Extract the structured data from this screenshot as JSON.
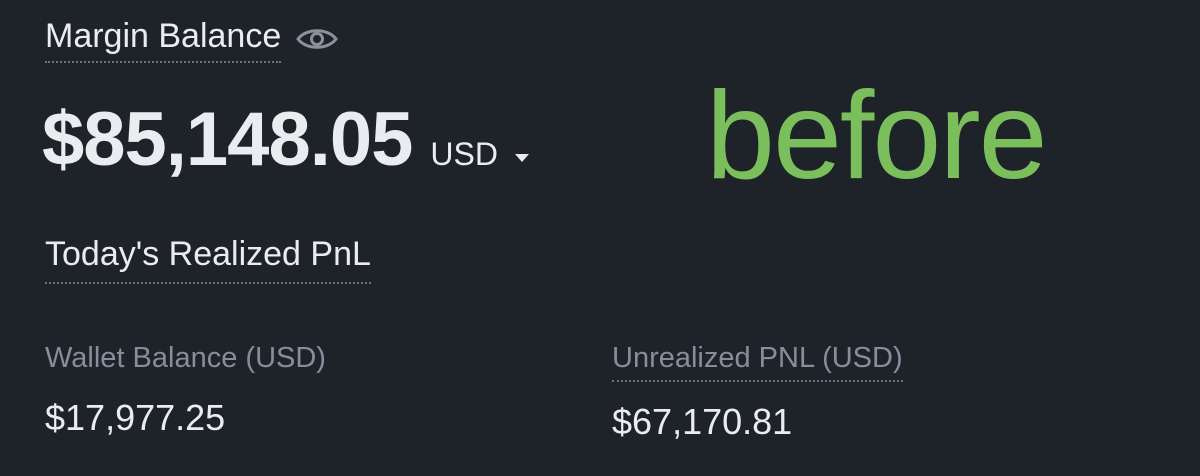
{
  "margin": {
    "label": "Margin Balance",
    "balance": "$85,148.05",
    "currency": "USD",
    "eye_icon": "eye-icon",
    "caret_icon": "caret-down-icon"
  },
  "overlay": {
    "text": "before",
    "color": "#7bbf5d"
  },
  "pnl": {
    "label": "Today's Realized PnL"
  },
  "wallet": {
    "label": "Wallet Balance (USD)",
    "value": "$17,977.25"
  },
  "unrealized": {
    "label": "Unrealized PNL (USD)",
    "value": "$67,170.81"
  },
  "colors": {
    "background": "#1e2329",
    "primary_text": "#eaecef",
    "secondary_text": "#848e9c"
  }
}
